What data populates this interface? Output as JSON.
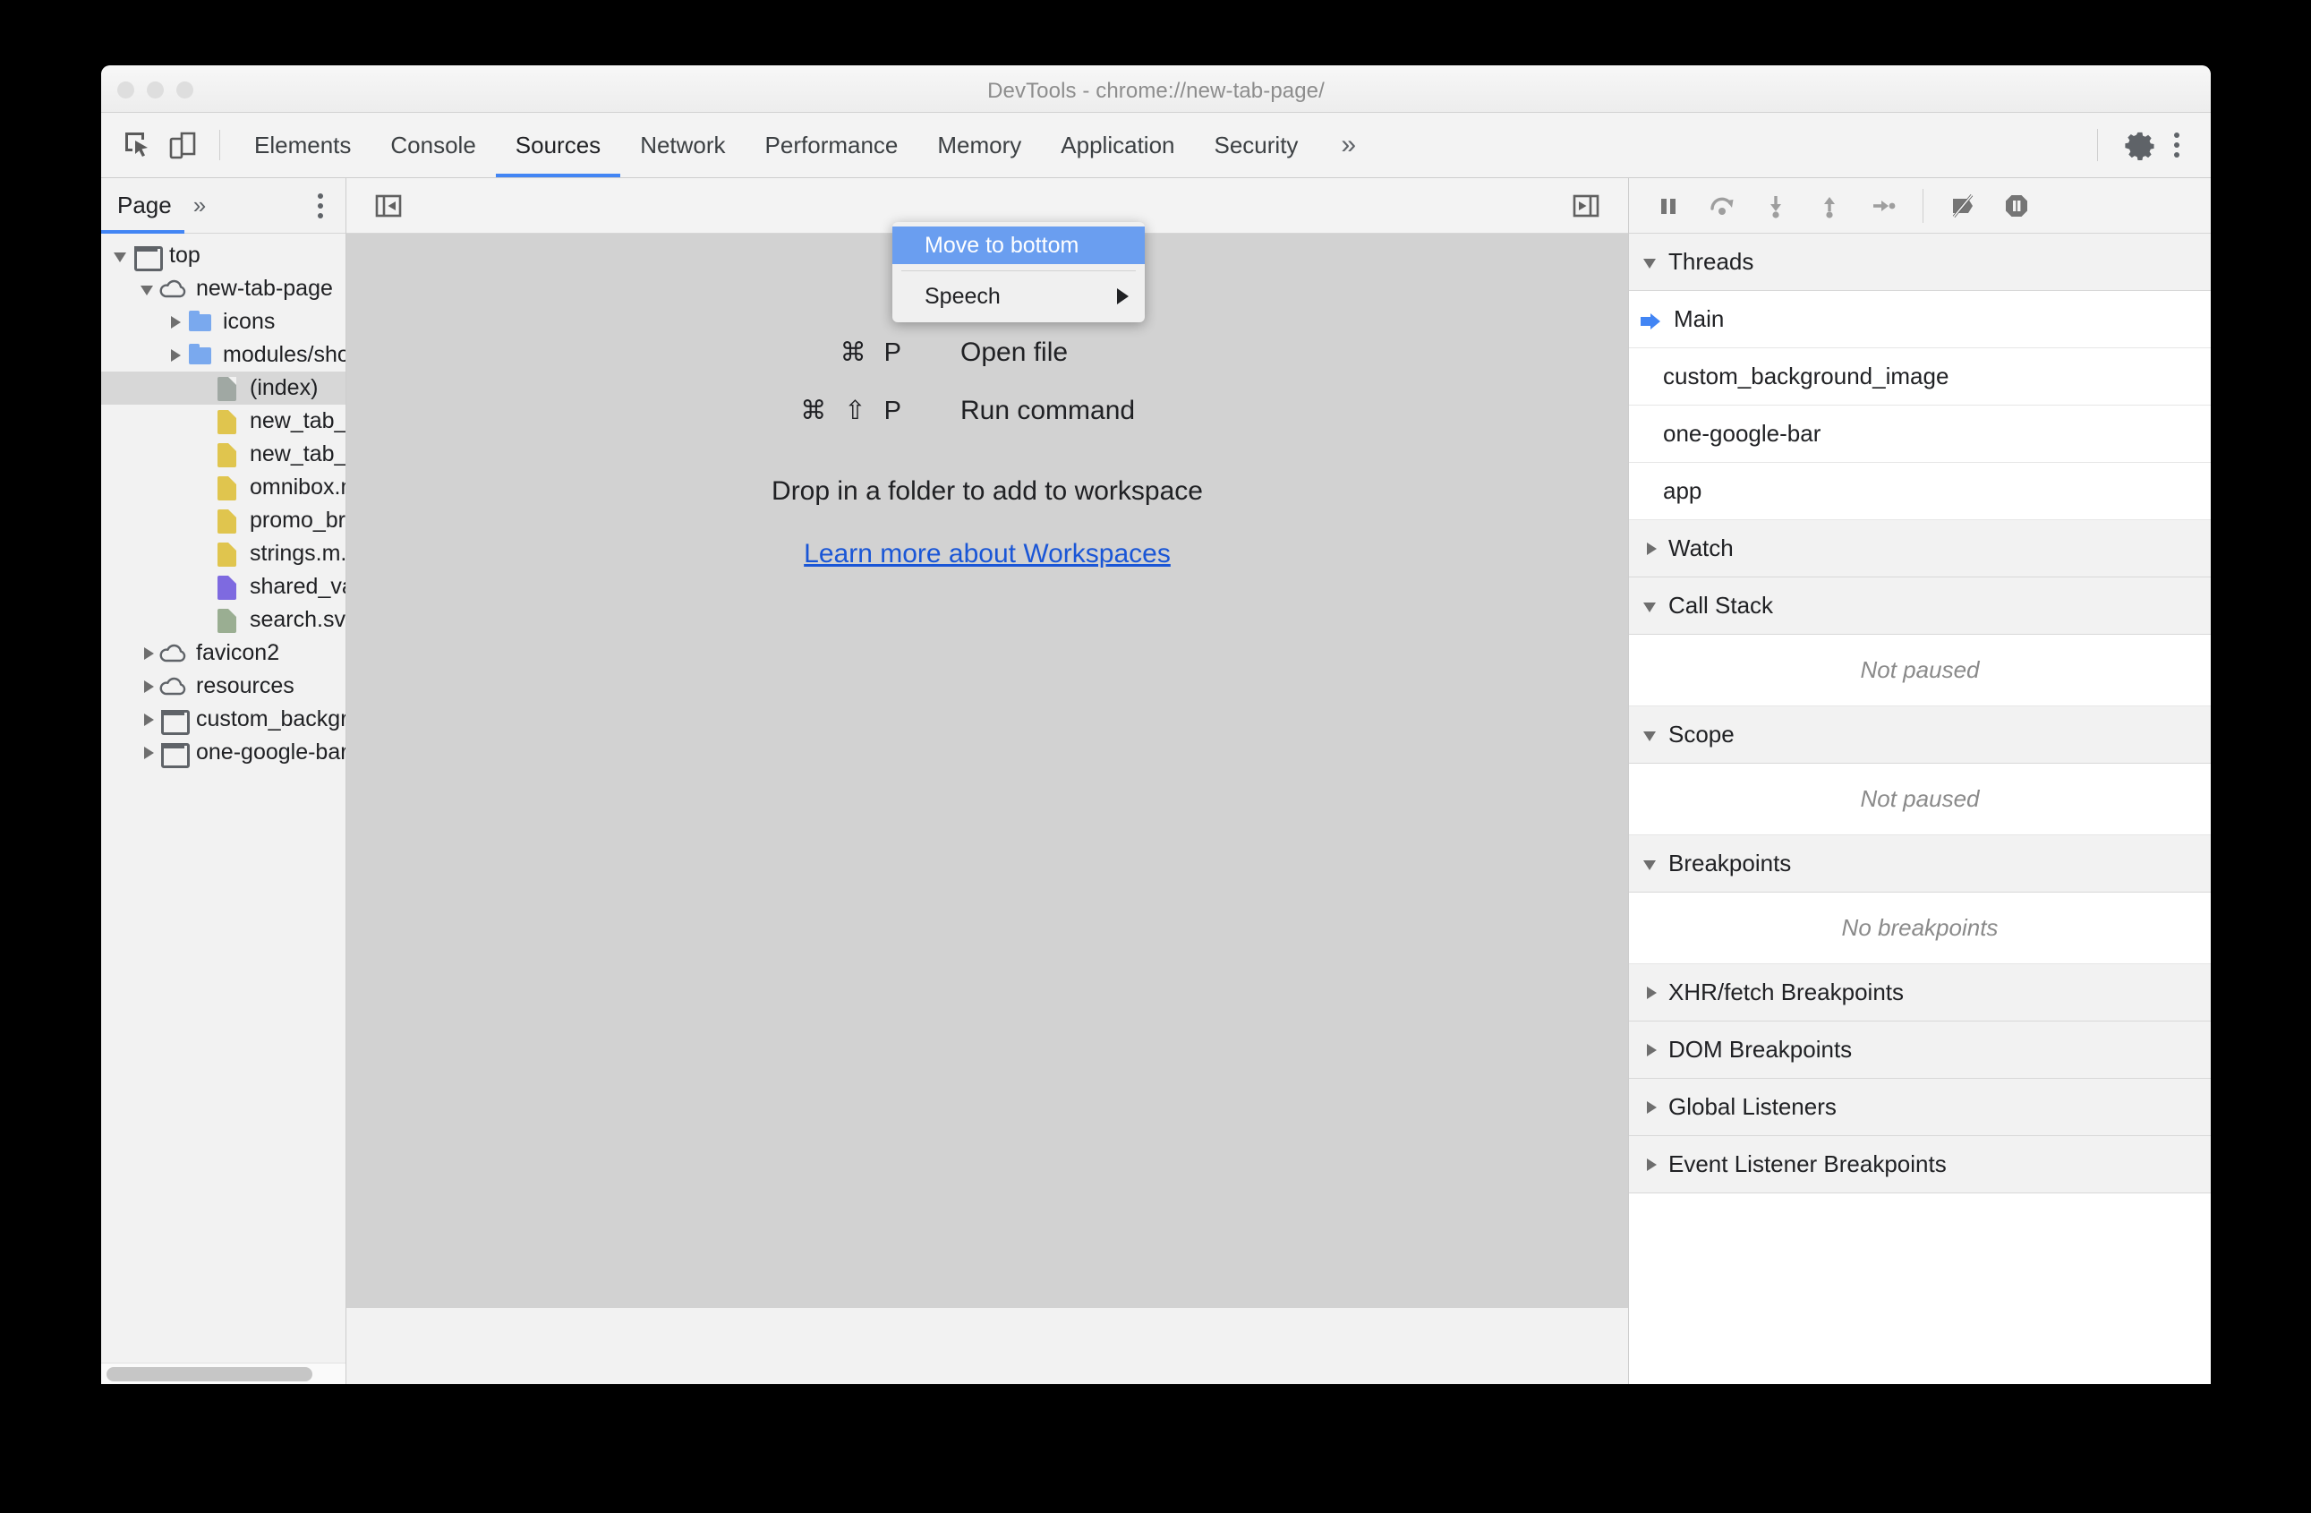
{
  "window": {
    "title": "DevTools - chrome://new-tab-page/",
    "traffic_lights": [
      "close-button",
      "minimize-button",
      "maximize-button"
    ]
  },
  "tabstrip": {
    "inspect_icon": "inspect-element-icon",
    "device_icon": "device-toolbar-icon",
    "tabs": [
      {
        "label": "Elements",
        "active": false
      },
      {
        "label": "Console",
        "active": false
      },
      {
        "label": "Sources",
        "active": true
      },
      {
        "label": "Network",
        "active": false
      },
      {
        "label": "Performance",
        "active": false
      },
      {
        "label": "Memory",
        "active": false
      },
      {
        "label": "Application",
        "active": false
      },
      {
        "label": "Security",
        "active": false
      }
    ],
    "overflow_label": "»",
    "settings_icon": "gear-icon",
    "more_icon": "kebab-menu-icon"
  },
  "context_menu": {
    "items": [
      {
        "label": "Move to bottom",
        "highlighted": true,
        "submenu": false
      },
      {
        "label": "Speech",
        "highlighted": false,
        "submenu": true
      }
    ]
  },
  "navigator": {
    "tab_label": "Page",
    "more_label": "»",
    "kebab_icon": "kebab-menu-icon",
    "tree": [
      {
        "label": "top",
        "indent": 0,
        "twisty": "open",
        "icon": "frame",
        "selected": false
      },
      {
        "label": "new-tab-page",
        "indent": 1,
        "twisty": "open",
        "icon": "cloud",
        "selected": false
      },
      {
        "label": "icons",
        "indent": 2,
        "twisty": "closed",
        "icon": "folder",
        "selected": false
      },
      {
        "label": "modules/shoppin",
        "indent": 2,
        "twisty": "closed",
        "icon": "folder",
        "selected": false
      },
      {
        "label": "(index)",
        "indent": 3,
        "twisty": "none",
        "icon": "doc",
        "selected": true
      },
      {
        "label": "new_tab_page.js",
        "indent": 3,
        "twisty": "none",
        "icon": "js",
        "selected": false
      },
      {
        "label": "new_tab_page.m",
        "indent": 3,
        "twisty": "none",
        "icon": "js",
        "selected": false
      },
      {
        "label": "omnibox.mojom-",
        "indent": 3,
        "twisty": "none",
        "icon": "js",
        "selected": false
      },
      {
        "label": "promo_browser_",
        "indent": 3,
        "twisty": "none",
        "icon": "js",
        "selected": false
      },
      {
        "label": "strings.m.js",
        "indent": 3,
        "twisty": "none",
        "icon": "js",
        "selected": false
      },
      {
        "label": "shared_vars.css",
        "indent": 3,
        "twisty": "none",
        "icon": "css",
        "selected": false
      },
      {
        "label": "search.svg",
        "indent": 3,
        "twisty": "none",
        "icon": "svg",
        "selected": false
      },
      {
        "label": "favicon2",
        "indent": 1,
        "twisty": "closed",
        "icon": "cloud",
        "selected": false
      },
      {
        "label": "resources",
        "indent": 1,
        "twisty": "closed",
        "icon": "cloud",
        "selected": false
      },
      {
        "label": "custom_backgroun",
        "indent": 1,
        "twisty": "closed",
        "icon": "frame",
        "selected": false
      },
      {
        "label": "one-google-bar",
        "indent": 1,
        "twisty": "closed",
        "icon": "frame",
        "selected": false
      }
    ],
    "scrollbar": "horizontal-scrollbar"
  },
  "editor": {
    "collapse_left_icon": "show-navigator-icon",
    "collapse_right_icon": "show-debugger-icon",
    "shortcuts": [
      {
        "keys": "⌘ P",
        "label": "Open file"
      },
      {
        "keys": "⌘ ⇧ P",
        "label": "Run command"
      }
    ],
    "drop_hint": "Drop in a folder to add to workspace",
    "link_label": "Learn more about Workspaces",
    "link_color": "#1a56d6"
  },
  "debugger": {
    "toolbar": [
      "pause-script-icon",
      "step-over-icon",
      "step-into-icon",
      "step-out-icon",
      "step-icon",
      "deactivate-breakpoints-icon",
      "pause-on-exceptions-icon"
    ],
    "sections": [
      {
        "title": "Threads",
        "expanded": true,
        "rows": [
          {
            "label": "Main",
            "current": true
          },
          {
            "label": "custom_background_image",
            "current": false
          },
          {
            "label": "one-google-bar",
            "current": false
          },
          {
            "label": "app",
            "current": false
          }
        ]
      },
      {
        "title": "Watch",
        "expanded": false,
        "rows": []
      },
      {
        "title": "Call Stack",
        "expanded": true,
        "empty_text": "Not paused",
        "rows": []
      },
      {
        "title": "Scope",
        "expanded": true,
        "empty_text": "Not paused",
        "rows": []
      },
      {
        "title": "Breakpoints",
        "expanded": true,
        "empty_text": "No breakpoints",
        "rows": []
      },
      {
        "title": "XHR/fetch Breakpoints",
        "expanded": false,
        "rows": []
      },
      {
        "title": "DOM Breakpoints",
        "expanded": false,
        "rows": []
      },
      {
        "title": "Global Listeners",
        "expanded": false,
        "rows": []
      },
      {
        "title": "Event Listener Breakpoints",
        "expanded": false,
        "rows": []
      }
    ]
  },
  "colors": {
    "accent": "#4285f4",
    "menu_highlight": "#6a9ef0",
    "link": "#1a56d6",
    "editor_bg": "#d2d2d2"
  }
}
